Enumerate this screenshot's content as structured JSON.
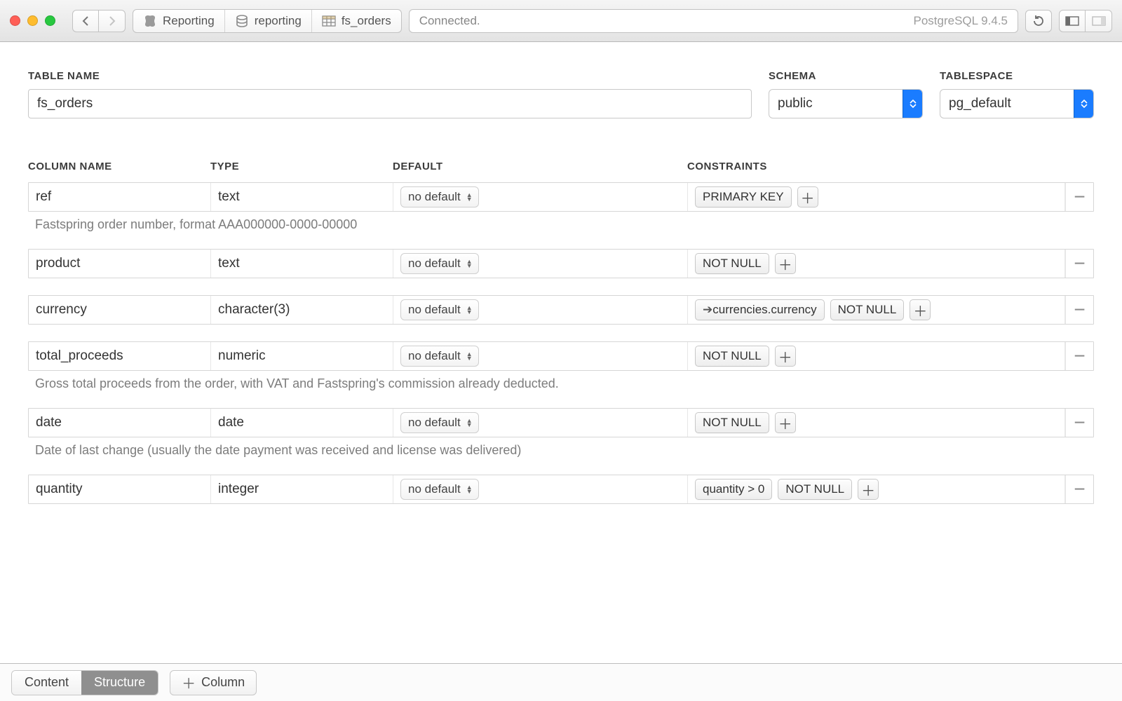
{
  "breadcrumb": {
    "server": "Reporting",
    "database": "reporting",
    "table": "fs_orders"
  },
  "status": {
    "text": "Connected.",
    "engine": "PostgreSQL 9.4.5"
  },
  "labels": {
    "table_name": "TABLE NAME",
    "schema": "SCHEMA",
    "tablespace": "TABLESPACE",
    "column_name": "COLUMN NAME",
    "type": "TYPE",
    "default": "DEFAULT",
    "constraints": "CONSTRAINTS"
  },
  "table": {
    "name": "fs_orders",
    "schema": "public",
    "tablespace": "pg_default"
  },
  "columns": [
    {
      "name": "ref",
      "type": "text",
      "default": "no default",
      "constraints": [
        "PRIMARY KEY"
      ],
      "fk": "",
      "desc": "Fastspring order number, format AAA000000-0000-00000"
    },
    {
      "name": "product",
      "type": "text",
      "default": "no default",
      "constraints": [
        "NOT NULL"
      ],
      "fk": "",
      "desc": ""
    },
    {
      "name": "currency",
      "type": "character(3)",
      "default": "no default",
      "constraints": [
        "NOT NULL"
      ],
      "fk": "currencies.currency",
      "desc": ""
    },
    {
      "name": "total_proceeds",
      "type": "numeric",
      "default": "no default",
      "constraints": [
        "NOT NULL"
      ],
      "fk": "",
      "desc": "Gross total proceeds from the order, with VAT and Fastspring's commission already deducted."
    },
    {
      "name": "date",
      "type": "date",
      "default": "no default",
      "constraints": [
        "NOT NULL"
      ],
      "fk": "",
      "desc": "Date of last change (usually the date payment was received and license was delivered)"
    },
    {
      "name": "quantity",
      "type": "integer",
      "default": "no default",
      "constraints": [
        "quantity > 0",
        "NOT NULL"
      ],
      "fk": "",
      "desc": ""
    }
  ],
  "tabs": {
    "content": "Content",
    "structure": "Structure",
    "add_column": "Column"
  }
}
